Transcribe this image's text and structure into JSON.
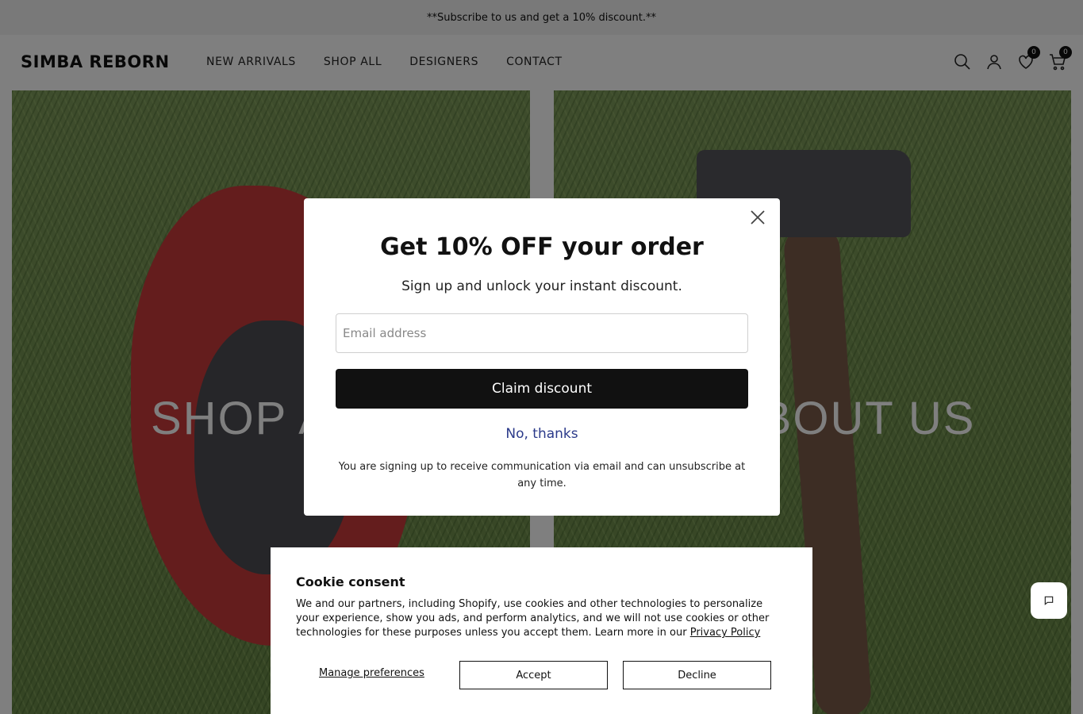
{
  "announcement": "**Subscribe to us and get a 10% discount.**",
  "header": {
    "logo": "SIMBA REBORN",
    "nav": [
      "NEW ARRIVALS",
      "SHOP ALL",
      "DESIGNERS",
      "CONTACT"
    ],
    "wishlist_count": "0",
    "cart_count": "0"
  },
  "hero": {
    "left_label": "SHOP ALL",
    "right_label": "ABOUT US"
  },
  "modal": {
    "title": "Get 10% OFF your order",
    "subtitle": "Sign up and unlock your instant discount.",
    "email_placeholder": "Email address",
    "claim_label": "Claim discount",
    "decline_label": "No, thanks",
    "disclaimer": "You are signing up to receive communication via email and can unsubscribe at any time."
  },
  "cookie": {
    "title": "Cookie consent",
    "text": "We and our partners, including Shopify, use cookies and other technologies to personalize your experience, show you ads, and perform analytics, and we will not use cookies or other technologies for these purposes unless you accept them. Learn more in our",
    "link_text": "Privacy Policy",
    "manage_label": "Manage preferences",
    "accept_label": "Accept",
    "decline_label": "Decline"
  }
}
